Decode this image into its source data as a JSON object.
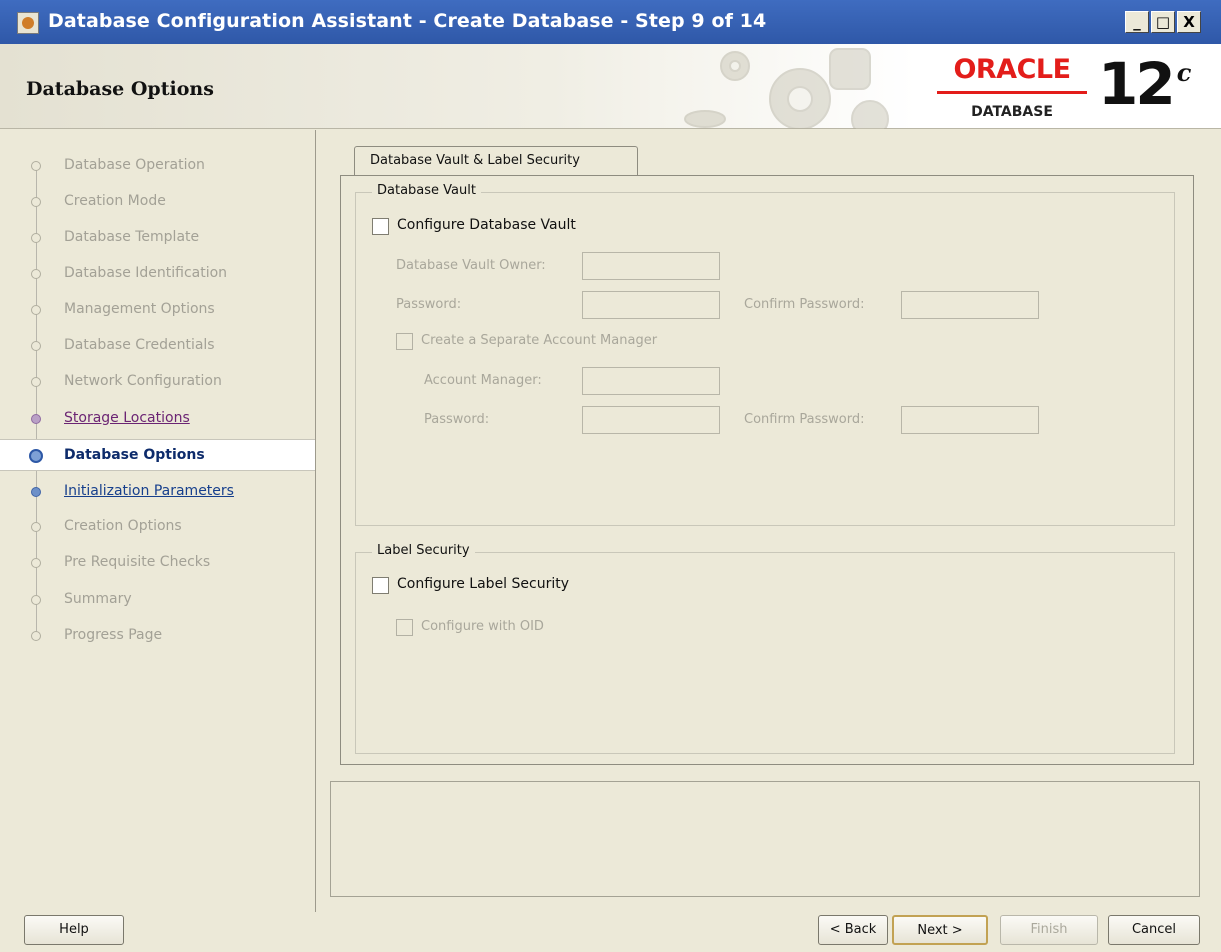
{
  "window": {
    "title": "Database Configuration Assistant - Create Database - Step 9 of 14",
    "min_label": "_",
    "max_label": "□",
    "close_label": "X"
  },
  "header": {
    "page_title": "Database Options",
    "brand": "ORACLE",
    "brand_sub": "DATABASE",
    "version": "12",
    "version_suffix": "c"
  },
  "nav": {
    "items": [
      {
        "label": "Database Operation",
        "state": "disabled"
      },
      {
        "label": "Creation Mode",
        "state": "disabled"
      },
      {
        "label": "Database Template",
        "state": "disabled"
      },
      {
        "label": "Database Identification",
        "state": "disabled"
      },
      {
        "label": "Management Options",
        "state": "disabled"
      },
      {
        "label": "Database Credentials",
        "state": "disabled"
      },
      {
        "label": "Network Configuration",
        "state": "disabled"
      },
      {
        "label": "Storage Locations",
        "state": "visited"
      },
      {
        "label": "Database Options",
        "state": "current"
      },
      {
        "label": "Initialization Parameters",
        "state": "link"
      },
      {
        "label": "Creation Options",
        "state": "disabled"
      },
      {
        "label": "Pre Requisite Checks",
        "state": "disabled"
      },
      {
        "label": "Summary",
        "state": "disabled"
      },
      {
        "label": "Progress Page",
        "state": "disabled"
      }
    ]
  },
  "tabs": [
    {
      "label": "Database Vault & Label Security"
    }
  ],
  "vault": {
    "group_title": "Database Vault",
    "configure_label": "Configure Database Vault",
    "configure_checked": false,
    "owner_label": "Database Vault Owner:",
    "owner_value": "",
    "password_label": "Password:",
    "password_value": "",
    "confirm_password_label": "Confirm Password:",
    "confirm_password_value": "",
    "separate_manager_label": "Create a Separate Account Manager",
    "separate_manager_checked": false,
    "account_manager_label": "Account Manager:",
    "account_manager_value": "",
    "am_password_label": "Password:",
    "am_password_value": "",
    "am_confirm_password_label": "Confirm Password:",
    "am_confirm_password_value": ""
  },
  "label_security": {
    "group_title": "Label Security",
    "configure_label": "Configure Label Security",
    "configure_checked": false,
    "oid_label": "Configure with OID",
    "oid_checked": false
  },
  "buttons": {
    "help": "Help",
    "back": "< Back",
    "next": "Next >",
    "finish": "Finish",
    "cancel": "Cancel"
  },
  "colors": {
    "titlebar": "#2f58a8",
    "oracle_red": "#e31d1a",
    "visited_link": "#6b2473",
    "link": "#163f8c"
  }
}
